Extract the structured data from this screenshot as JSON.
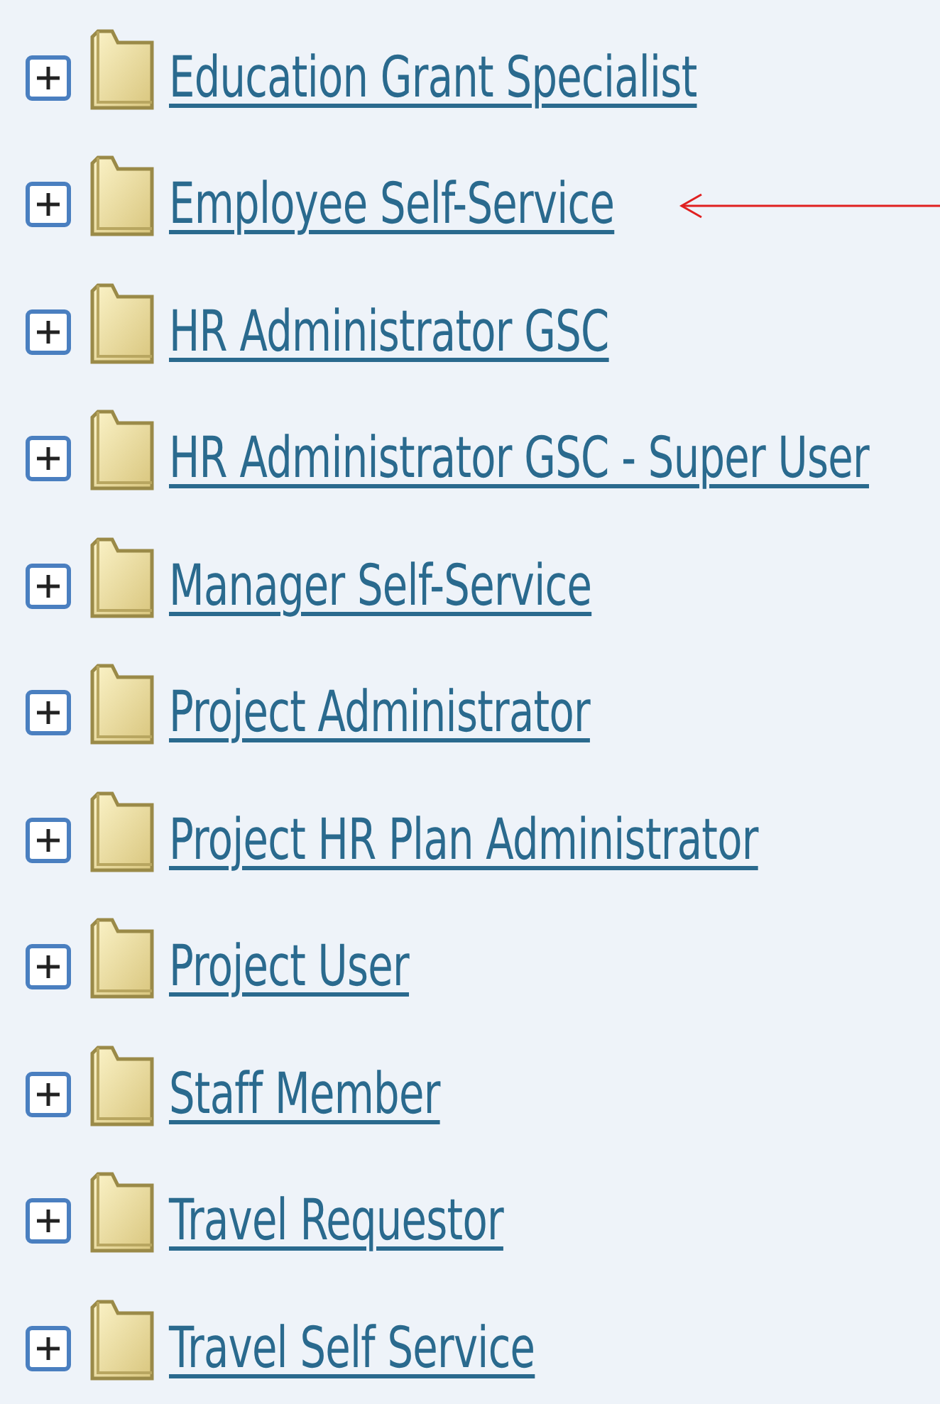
{
  "tree": {
    "items": [
      {
        "label": "Education Grant Specialist",
        "expanded": false,
        "annotated": false
      },
      {
        "label": "Employee Self-Service",
        "expanded": false,
        "annotated": true
      },
      {
        "label": "HR Administrator GSC",
        "expanded": false,
        "annotated": false
      },
      {
        "label": "HR Administrator GSC - Super User",
        "expanded": false,
        "annotated": false
      },
      {
        "label": "Manager Self-Service",
        "expanded": false,
        "annotated": false
      },
      {
        "label": "Project Administrator",
        "expanded": false,
        "annotated": false
      },
      {
        "label": "Project HR Plan Administrator",
        "expanded": false,
        "annotated": false
      },
      {
        "label": "Project User",
        "expanded": false,
        "annotated": false
      },
      {
        "label": "Staff Member",
        "expanded": false,
        "annotated": false
      },
      {
        "label": "Travel Requestor",
        "expanded": false,
        "annotated": false
      },
      {
        "label": "Travel Self Service",
        "expanded": false,
        "annotated": false
      }
    ]
  }
}
